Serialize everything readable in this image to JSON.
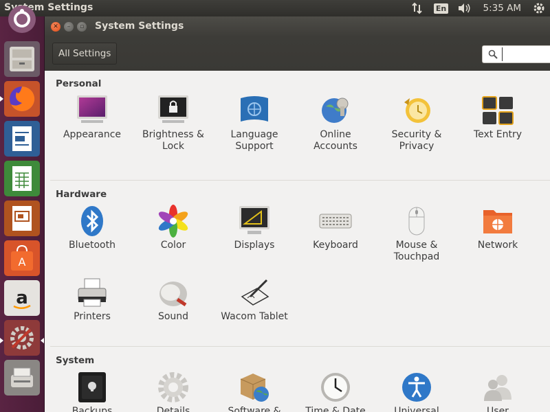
{
  "top_panel": {
    "title": "System Settings",
    "keyboard_layout": "En",
    "clock": "5:35 AM",
    "icons": [
      "network-updown-icon",
      "keyboard-layout-indicator",
      "volume-icon",
      "session-gear-icon"
    ]
  },
  "launcher": {
    "items": [
      {
        "name": "dash",
        "icon": "ubuntu-dash-icon"
      },
      {
        "name": "files",
        "icon": "file-cabinet-icon"
      },
      {
        "name": "firefox",
        "icon": "firefox-icon"
      },
      {
        "name": "writer",
        "icon": "libreoffice-writer-icon"
      },
      {
        "name": "calc",
        "icon": "libreoffice-calc-icon"
      },
      {
        "name": "impress",
        "icon": "libreoffice-impress-icon"
      },
      {
        "name": "software-center",
        "icon": "software-center-bag-icon"
      },
      {
        "name": "amazon",
        "icon": "amazon-icon"
      },
      {
        "name": "system-settings",
        "icon": "system-settings-icon"
      },
      {
        "name": "scanner",
        "icon": "scanner-icon"
      }
    ]
  },
  "window": {
    "title": "System Settings",
    "toolbar": {
      "all_settings": "All Settings",
      "search_placeholder": ""
    }
  },
  "sections": [
    {
      "title": "Personal",
      "items": [
        {
          "label": "Appearance",
          "icon": "appearance-monitor-icon"
        },
        {
          "label": "Brightness &\nLock",
          "icon": "brightness-lock-icon"
        },
        {
          "label": "Language\nSupport",
          "icon": "language-flag-icon"
        },
        {
          "label": "Online\nAccounts",
          "icon": "online-accounts-globe-icon"
        },
        {
          "label": "Security &\nPrivacy",
          "icon": "security-privacy-icon"
        },
        {
          "label": "Text Entry",
          "icon": "text-entry-keys-icon"
        }
      ]
    },
    {
      "title": "Hardware",
      "items": [
        {
          "label": "Bluetooth",
          "icon": "bluetooth-icon"
        },
        {
          "label": "Color",
          "icon": "color-flower-icon"
        },
        {
          "label": "Displays",
          "icon": "displays-monitor-icon"
        },
        {
          "label": "Keyboard",
          "icon": "keyboard-icon"
        },
        {
          "label": "Mouse &\nTouchpad",
          "icon": "mouse-icon"
        },
        {
          "label": "Network",
          "icon": "network-folder-icon"
        },
        {
          "label": "Printers",
          "icon": "printer-icon"
        },
        {
          "label": "Sound",
          "icon": "sound-speaker-icon"
        },
        {
          "label": "Wacom Tablet",
          "icon": "wacom-tablet-icon"
        }
      ]
    },
    {
      "title": "System",
      "items": [
        {
          "label": "Backups",
          "icon": "backups-safe-icon"
        },
        {
          "label": "Details",
          "icon": "details-gear-icon"
        },
        {
          "label": "Software &\nUpdates",
          "icon": "software-updates-icon"
        },
        {
          "label": "Time & Date",
          "icon": "clock-icon"
        },
        {
          "label": "Universal\nAccess",
          "icon": "universal-access-icon"
        },
        {
          "label": "User\nAccounts",
          "icon": "user-accounts-icon"
        }
      ]
    }
  ]
}
